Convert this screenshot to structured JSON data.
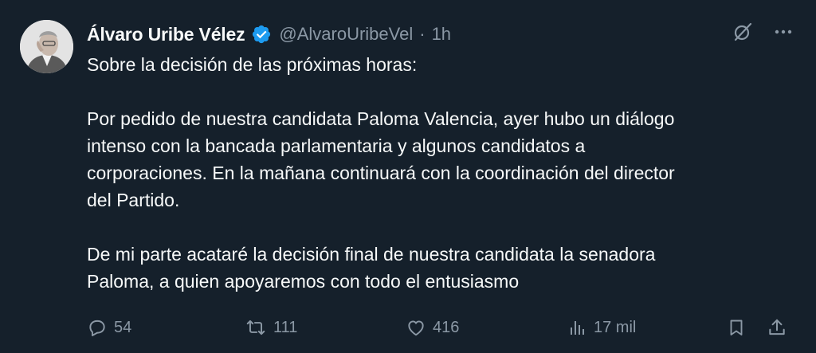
{
  "author": {
    "name": "Álvaro Uribe Vélez",
    "handle": "@AlvaroUribeVel",
    "separator": "·",
    "time": "1h",
    "verified_icon": "verified-badge-icon",
    "avatar": "profile-photo"
  },
  "header_icons": {
    "grok": "grok-icon",
    "more": "more-options-icon"
  },
  "tweet": {
    "line1": "Sobre la decisión de las próximas horas:",
    "paragraph2": [
      "Por pedido de nuestra candidata Paloma Valencia, ayer hubo un diálogo",
      "intenso con la bancada parlamentaria y algunos candidatos a",
      "corporaciones. En la mañana continuará con la coordinación del director",
      "del Partido."
    ],
    "paragraph3": [
      "De mi parte acataré la decisión final de nuestra candidata la senadora",
      "Paloma, a quien apoyaremos con todo el entusiasmo"
    ]
  },
  "actions": {
    "replies": "54",
    "retweets": "111",
    "likes": "416",
    "views": "17 mil",
    "icons": [
      "reply-icon",
      "retweet-icon",
      "like-icon",
      "views-icon",
      "bookmark-icon",
      "share-icon"
    ]
  },
  "colors": {
    "background": "#15202b",
    "text": "#f7f9f9",
    "secondary": "#8b98a5",
    "verified": "#1d9bf0"
  }
}
